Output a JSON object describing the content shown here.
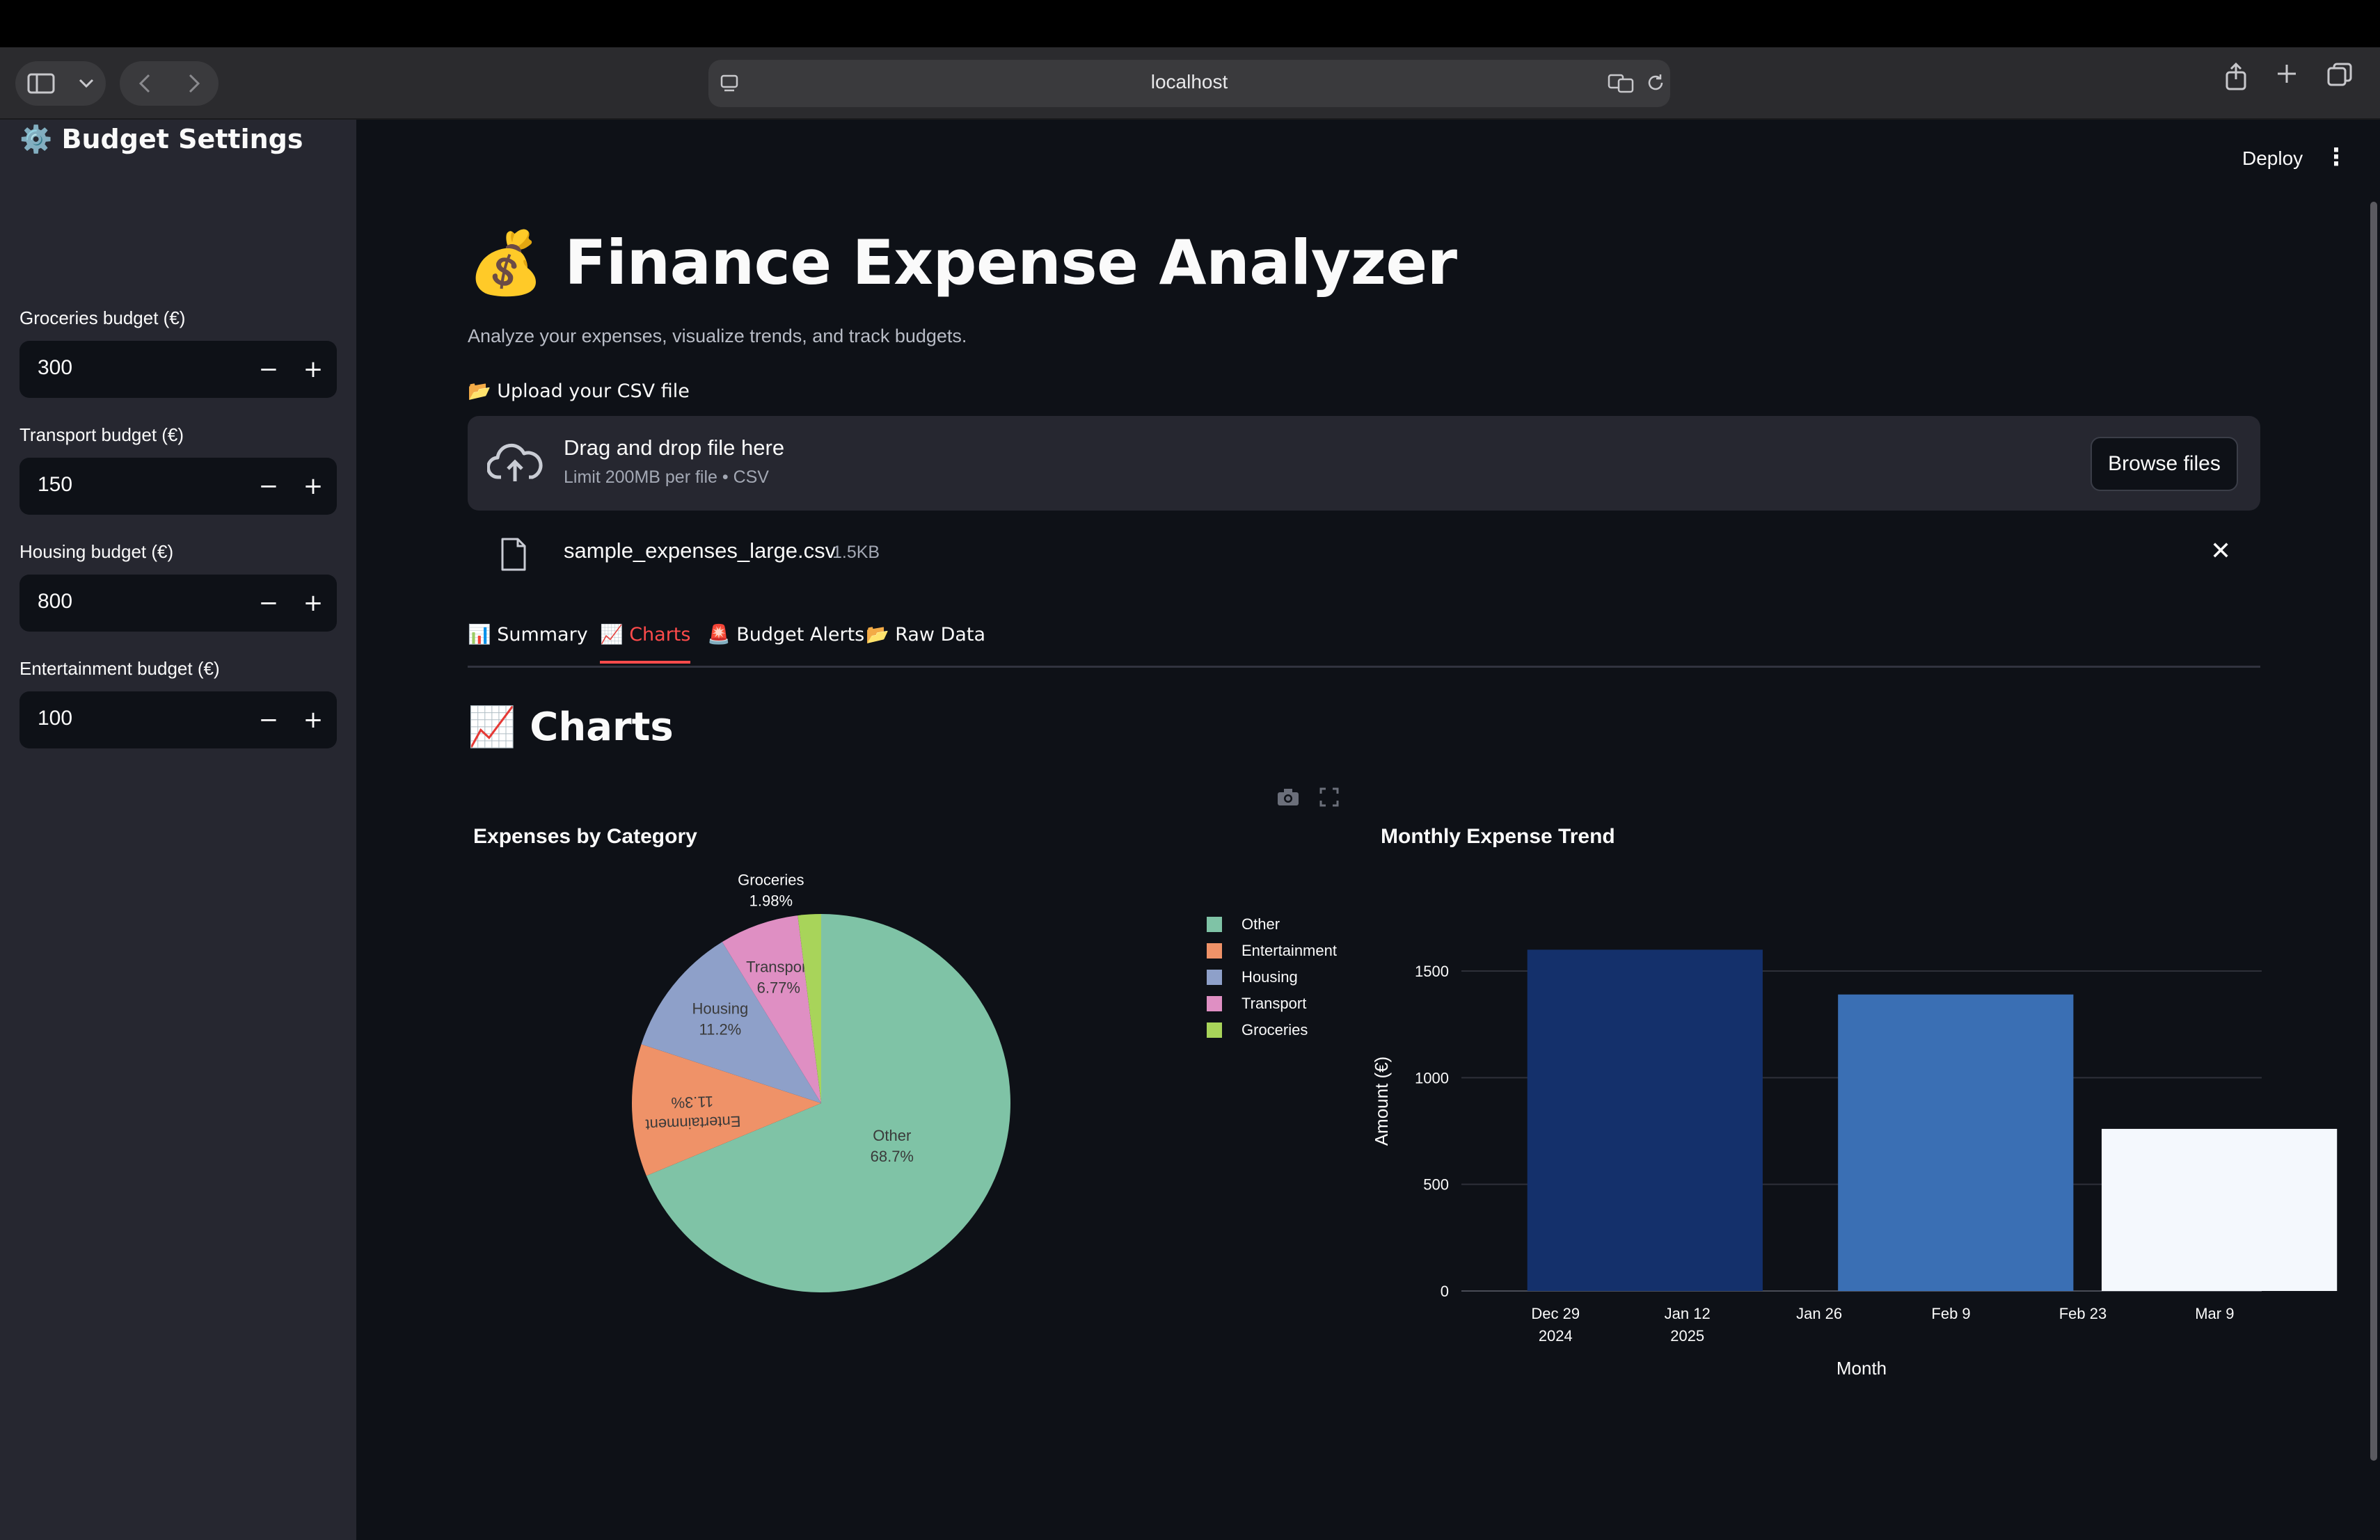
{
  "browser": {
    "url": "localhost"
  },
  "app": {
    "deploy_label": "Deploy",
    "title": "💰 Finance Expense Analyzer",
    "subtitle": "Analyze your expenses, visualize trends, and track budgets."
  },
  "sidebar": {
    "title": "⚙️ Budget Settings",
    "budgets": [
      {
        "label": "Groceries budget (€)",
        "value": "300"
      },
      {
        "label": "Transport budget (€)",
        "value": "150"
      },
      {
        "label": "Housing budget (€)",
        "value": "800"
      },
      {
        "label": "Entertainment budget (€)",
        "value": "100"
      }
    ],
    "minus": "−",
    "plus": "+"
  },
  "upload": {
    "label": "📂 Upload your CSV file",
    "drag_text": "Drag and drop file here",
    "limit_text": "Limit 200MB per file • CSV",
    "browse_label": "Browse files",
    "file_name": "sample_expenses_large.csv",
    "file_size": "1.5KB"
  },
  "tabs": [
    {
      "label": "📊 Summary",
      "active": false
    },
    {
      "label": "📈 Charts",
      "active": true
    },
    {
      "label": "🚨 Budget Alerts",
      "active": false
    },
    {
      "label": "📂 Raw Data",
      "active": false
    }
  ],
  "section": {
    "title": "📈 Charts"
  },
  "chart_data": [
    {
      "type": "pie",
      "title": "Expenses by Category",
      "slices": [
        {
          "label": "Other",
          "percent": 68.7,
          "percent_label": "68.7%",
          "color": "#7fc3a6"
        },
        {
          "label": "Entertainment",
          "percent": 11.3,
          "percent_label": "11.3%",
          "color": "#ef9268"
        },
        {
          "label": "Housing",
          "percent": 11.2,
          "percent_label": "11.2%",
          "color": "#8ea0c9"
        },
        {
          "label": "Transport",
          "percent": 6.77,
          "percent_label": "6.77%",
          "color": "#df8fc3"
        },
        {
          "label": "Groceries",
          "percent": 1.98,
          "percent_label": "1.98%",
          "color": "#a8d45a"
        }
      ],
      "legend": [
        "Other",
        "Entertainment",
        "Housing",
        "Transport",
        "Groceries"
      ],
      "legend_position": "right"
    },
    {
      "type": "bar",
      "title": "Monthly Expense Trend",
      "xlabel": "Month",
      "ylabel": "Amount (€)",
      "ylim": [
        0,
        1650
      ],
      "yticks": [
        0,
        500,
        1000,
        1500
      ],
      "x_axis_type": "date",
      "x_range": [
        "2024-12-19",
        "2025-03-14"
      ],
      "xticks": [
        {
          "date": "2024-12-29",
          "label": "Dec 29",
          "sublabel": "2024"
        },
        {
          "date": "2025-01-12",
          "label": "Jan 12",
          "sublabel": "2025"
        },
        {
          "date": "2025-01-26",
          "label": "Jan 26",
          "sublabel": ""
        },
        {
          "date": "2025-02-09",
          "label": "Feb 9",
          "sublabel": ""
        },
        {
          "date": "2025-02-23",
          "label": "Feb 23",
          "sublabel": ""
        },
        {
          "date": "2025-03-09",
          "label": "Mar 9",
          "sublabel": ""
        }
      ],
      "bars": [
        {
          "start": "2024-12-26",
          "end": "2025-01-20",
          "value": 1600,
          "color": "#14306b"
        },
        {
          "start": "2025-01-28",
          "end": "2025-02-22",
          "value": 1390,
          "color": "#3a6fb4"
        },
        {
          "start": "2025-02-25",
          "end": "2025-03-22",
          "value": 760,
          "color": "#f4f8fd"
        }
      ],
      "grid": true
    }
  ]
}
